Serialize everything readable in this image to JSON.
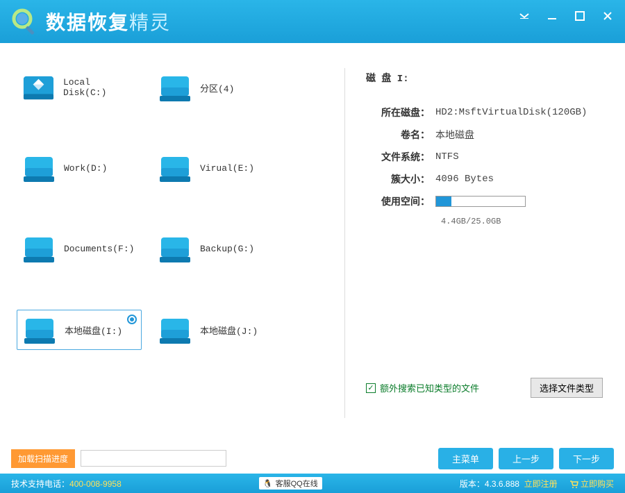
{
  "app": {
    "title_main": "数据恢复",
    "title_accent": "精灵"
  },
  "disks": [
    {
      "label": "Local Disk(C:)",
      "special": true,
      "selected": false
    },
    {
      "label": "分区(4)",
      "special": false,
      "selected": false
    },
    {
      "label": "Work(D:)",
      "special": false,
      "selected": false
    },
    {
      "label": "Virual(E:)",
      "special": false,
      "selected": false
    },
    {
      "label": "Documents(F:)",
      "special": false,
      "selected": false
    },
    {
      "label": "Backup(G:)",
      "special": false,
      "selected": false
    },
    {
      "label": "本地磁盘(I:)",
      "special": false,
      "selected": true
    },
    {
      "label": "本地磁盘(J:)",
      "special": false,
      "selected": false
    }
  ],
  "info": {
    "title": "磁 盘  I:",
    "host_disk_label": "所在磁盘：",
    "host_disk_value": "HD2:MsftVirtualDisk(120GB)",
    "volume_label": "卷名：",
    "volume_value": "本地磁盘",
    "filesystem_label": "文件系统：",
    "filesystem_value": "NTFS",
    "cluster_label": "簇大小：",
    "cluster_value": "4096 Bytes",
    "usage_label": "使用空间：",
    "usage_percent": 17,
    "usage_text": "4.4GB/25.0GB"
  },
  "options": {
    "extra_search_label": "额外搜索已知类型的文件",
    "file_type_button": "选择文件类型"
  },
  "actions": {
    "load_progress": "加载扫描进度",
    "main_menu": "主菜单",
    "prev": "上一步",
    "next": "下一步"
  },
  "status": {
    "support_prefix": "技术支持电话：",
    "support_phone": "400-008-9958",
    "qq_label": "客服QQ在线",
    "version_prefix": "版本：",
    "version": "4.3.6.888",
    "register": "立即注册",
    "buy": "立即购买"
  }
}
